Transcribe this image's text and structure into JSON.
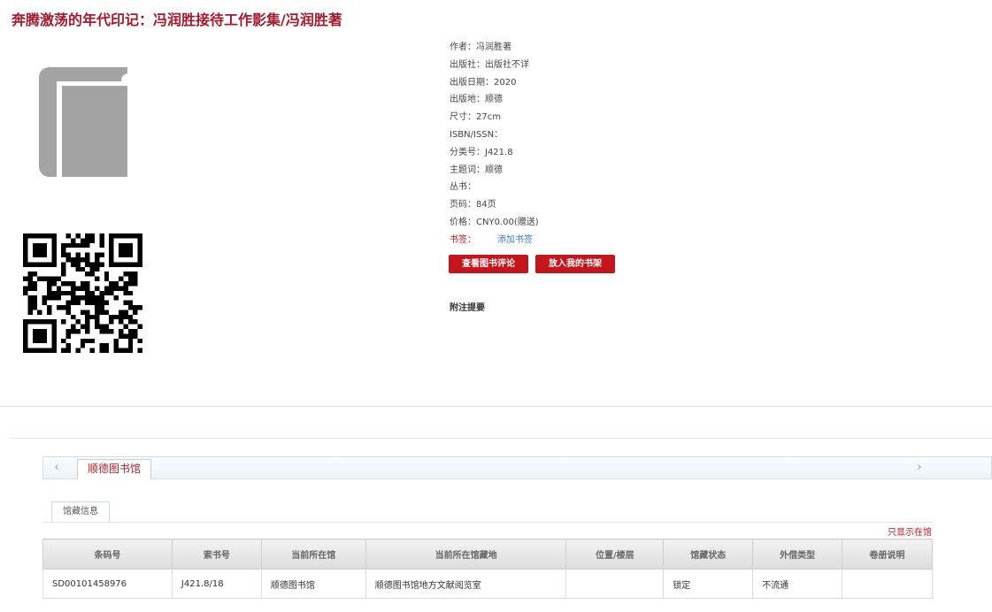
{
  "title": "奔腾激荡的年代印记：冯润胜接待工作影集/冯润胜著",
  "meta": [
    {
      "label": "作者：",
      "value": "冯润胜著"
    },
    {
      "label": "出版社：",
      "value": "出版社不详"
    },
    {
      "label": "出版日期：",
      "value": "2020"
    },
    {
      "label": "出版地：",
      "value": "顺德"
    },
    {
      "label": "尺寸：",
      "value": "27cm"
    },
    {
      "label": "ISBN/ISSN：",
      "value": ""
    },
    {
      "label": "分类号：",
      "value": "J421.8"
    },
    {
      "label": "主题词：",
      "value": "顺德"
    },
    {
      "label": "丛书：",
      "value": ""
    },
    {
      "label": "页码：",
      "value": "84页"
    },
    {
      "label": "价格：",
      "value": "CNY0.00(赠送)"
    }
  ],
  "bookmark": {
    "label": "书签：",
    "link": "添加书签"
  },
  "buttons": {
    "review": "查看图书评论",
    "shelf": "放入我的书架"
  },
  "note_title": "附注提要",
  "tabs": {
    "prev": "‹",
    "next": "›",
    "active": "顺德图书馆"
  },
  "subtab": "馆藏信息",
  "only_in_library": "只显示在馆",
  "table": {
    "headers": [
      "条码号",
      "索书号",
      "当前所在馆",
      "当前所在馆藏地",
      "位置/楼层",
      "馆藏状态",
      "外借类型",
      "卷册说明"
    ],
    "rows": [
      [
        "SD00101458976",
        "J421.8/18",
        "顺德图书馆",
        "顺德图书馆地方文献阅览室",
        "",
        "锁定",
        "不流通",
        ""
      ]
    ]
  },
  "colors": {
    "accent": "#a5192e",
    "button": "#c4161c",
    "link": "#3a7dc9"
  }
}
